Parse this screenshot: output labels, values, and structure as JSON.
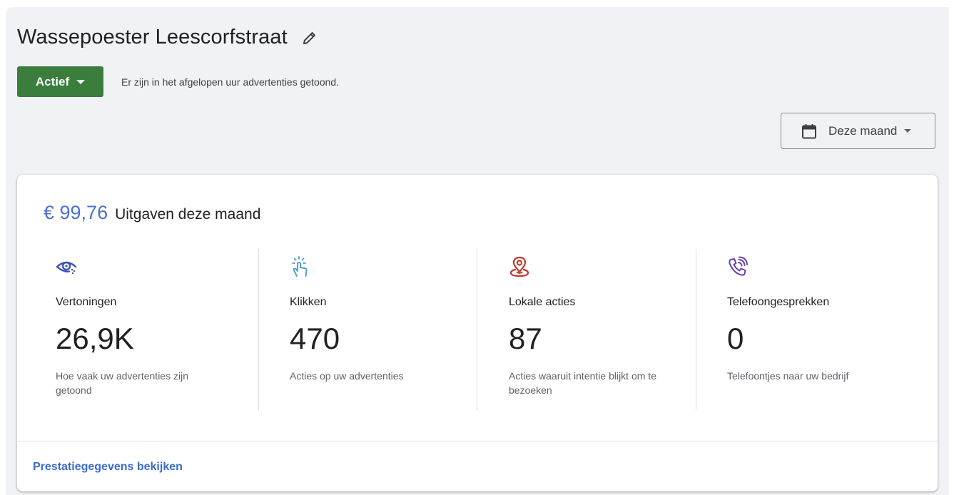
{
  "header": {
    "title": "Wassepoester Leescorfstraat"
  },
  "status": {
    "label": "Actief",
    "message": "Er zijn in het afgelopen uur advertenties getoond."
  },
  "date_filter": {
    "label": "Deze maand"
  },
  "summary": {
    "amount": "€ 99,76",
    "label": "Uitgaven deze maand",
    "metrics": [
      {
        "name": "Vertoningen",
        "value": "26,9K",
        "description": "Hoe vaak uw advertenties zijn getoond",
        "icon": "eye-icon",
        "color": "#3f51b5"
      },
      {
        "name": "Klikken",
        "value": "470",
        "description": "Acties op uw advertenties",
        "icon": "tap-icon",
        "color": "#4fa3c7"
      },
      {
        "name": "Lokale acties",
        "value": "87",
        "description": "Acties waaruit intentie blijkt om te bezoeken",
        "icon": "location-pin-icon",
        "color": "#c0392b"
      },
      {
        "name": "Telefoongesprekken",
        "value": "0",
        "description": "Telefoontjes naar uw bedrijf",
        "icon": "phone-ringing-icon",
        "color": "#6a3fb0"
      }
    ]
  },
  "footer": {
    "link_label": "Prestatiegegevens bekijken"
  },
  "colors": {
    "status_green": "#3a7d3c",
    "link_blue": "#3a6bd1",
    "amount_blue": "#4a6fd8",
    "page_bg": "#f0f2f5"
  }
}
